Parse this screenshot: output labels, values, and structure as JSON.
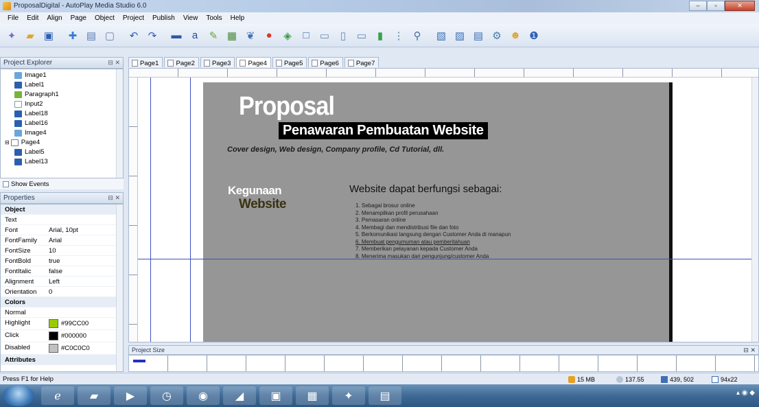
{
  "window": {
    "title": "ProposalDigital - AutoPlay Media Studio 6.0",
    "controls": [
      "–",
      "▫",
      "✕"
    ]
  },
  "menu": [
    "File",
    "Edit",
    "Align",
    "Page",
    "Object",
    "Project",
    "Publish",
    "View",
    "Tools",
    "Help"
  ],
  "explorer": {
    "title": "Project Explorer",
    "items": [
      {
        "label": "Image1",
        "icon": "image-icon",
        "indent": 2
      },
      {
        "label": "Label1",
        "icon": "label-icon",
        "indent": 2
      },
      {
        "label": "Paragraph1",
        "icon": "paragraph-icon",
        "indent": 2
      },
      {
        "label": "Input2",
        "icon": "input-icon",
        "indent": 2
      },
      {
        "label": "Label18",
        "icon": "label-icon",
        "indent": 2
      },
      {
        "label": "Label16",
        "icon": "label-icon",
        "indent": 2
      },
      {
        "label": "Image4",
        "icon": "image-icon",
        "indent": 2
      },
      {
        "label": "Page4",
        "icon": "page-icon",
        "indent": 1
      },
      {
        "label": "Label5",
        "icon": "label-icon",
        "indent": 2
      },
      {
        "label": "Label13",
        "icon": "label-icon",
        "indent": 2
      }
    ],
    "show_events": "Show Events"
  },
  "properties": {
    "title": "Properties",
    "rows": [
      {
        "key": "Object",
        "value": "",
        "group": true
      },
      {
        "key": "Text",
        "value": ""
      },
      {
        "key": "Font",
        "value": "Arial, 10pt"
      },
      {
        "key": "FontFamily",
        "value": "Arial"
      },
      {
        "key": "FontSize",
        "value": "10"
      },
      {
        "key": "FontBold",
        "value": "true"
      },
      {
        "key": "FontItalic",
        "value": "false"
      },
      {
        "key": "Alignment",
        "value": "Left"
      },
      {
        "key": "Orientation",
        "value": "0"
      },
      {
        "key": "Colors",
        "value": "",
        "group": true
      },
      {
        "key": "Normal",
        "value": ""
      },
      {
        "key": "Highlight",
        "value": "#99CC00",
        "swatch": "#99cc00"
      },
      {
        "key": "Click",
        "value": "#000000",
        "swatch": "#000000"
      },
      {
        "key": "Disabled",
        "value": "#C0C0C0",
        "swatch": "#c0c0c0"
      },
      {
        "key": "Attributes",
        "value": "",
        "group": true
      }
    ]
  },
  "tabs": [
    "Page1",
    "Page2",
    "Page3",
    "Page4",
    "Page5",
    "Page6",
    "Page7"
  ],
  "active_tab": "Page4",
  "page": {
    "title": "Proposal",
    "subtitle": "Penawaran Pembuatan Website",
    "tagline": "Cover design, Web design, Company profile, Cd Tutorial, dll.",
    "kegunaan_1": "Kegunaan",
    "kegunaan_2": "Website",
    "heading": "Website dapat berfungsi sebagai:",
    "list": [
      "1. Sebagai brosur online",
      "2. Menampilkan profil perusahaan",
      "3. Pemasaran online",
      "4. Membagi dan mendistribusi file dan foto",
      "5. Berkomunikasi langsung dengan Customer Anda di manapun",
      "6. Membuat pengumuman atau pemberitahuan",
      "7. Memberikan pelayanan kepada Customer Anda",
      "8. Menerima masukan dari pengunjung/customer Anda"
    ]
  },
  "project_size": {
    "title": "Project Size",
    "fill_fraction": 0.02
  },
  "status": {
    "help": "Press F1 for Help",
    "memory": "15 MB",
    "disk": "137.55",
    "coords": "439, 502",
    "size": "94x22"
  },
  "colors": {
    "page_bg": "#969696",
    "guide": "#3f4ec0",
    "accent_black": "#000000"
  }
}
